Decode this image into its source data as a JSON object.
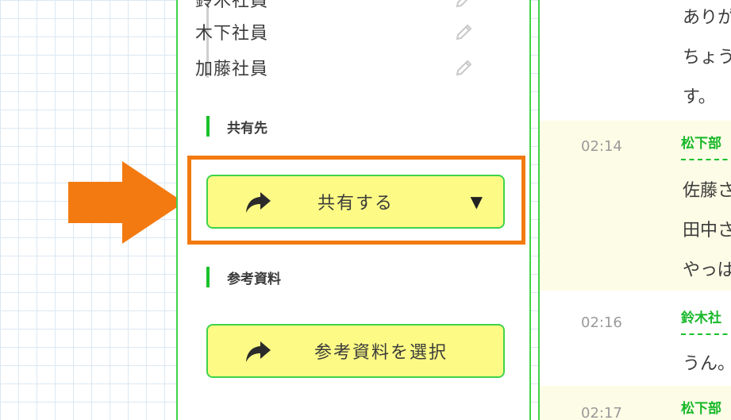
{
  "members": [
    {
      "name": "鈴木社員",
      "icon": "pencil-icon"
    },
    {
      "name": "木下社員",
      "icon": "pencil-icon"
    },
    {
      "name": "加藤社員",
      "icon": "pencil-icon"
    }
  ],
  "share_section": {
    "label": "共有先",
    "button_label": "共有する",
    "button_icon": "share-arrow-icon",
    "caret": "▼"
  },
  "reference_section": {
    "label": "参考資料",
    "button_label": "参考資料を選択",
    "button_icon": "share-arrow-icon"
  },
  "chat": {
    "top_lines": [
      "ありが",
      "ちょう",
      "す。"
    ],
    "messages": [
      {
        "time": "02:14",
        "sender": "松下部",
        "lines": [
          "佐藤さ",
          "田中さ",
          "やっぱ"
        ]
      },
      {
        "time": "02:16",
        "sender": "鈴木社",
        "lines": [
          "うん。"
        ]
      },
      {
        "time": "02:17",
        "sender": "松下部",
        "lines": []
      }
    ]
  },
  "colors": {
    "accent_green": "#3fd34a",
    "button_yellow": "#fdfb85",
    "highlight_orange": "#f37a10",
    "chat_yellow": "#fdfce6"
  }
}
